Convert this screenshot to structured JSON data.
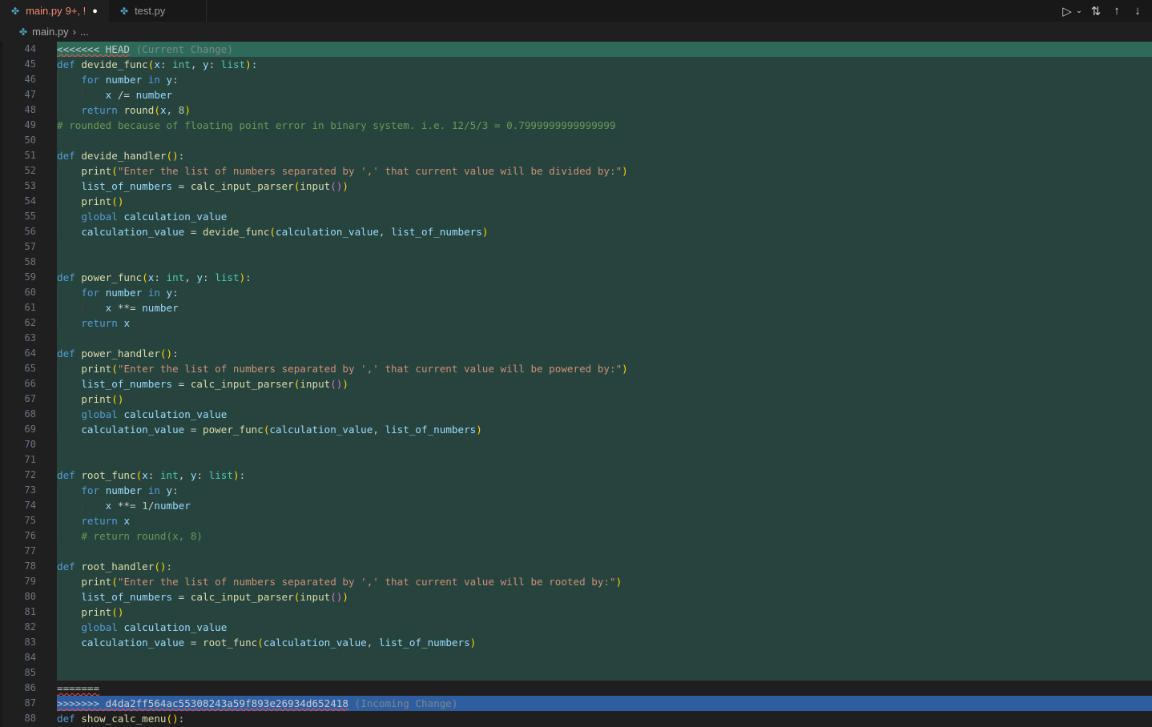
{
  "tabs": [
    {
      "label": "main.py",
      "badge": "9+, !",
      "dirty": "●",
      "active": true
    },
    {
      "label": "test.py",
      "active": false
    }
  ],
  "toolbar": {
    "run_icon": "play-icon",
    "run_dropdown_icon": "chevron-down-icon",
    "compare_icon": "git-compare-icon",
    "prev_icon": "arrow-up-icon",
    "next_icon": "arrow-down-icon"
  },
  "breadcrumb": {
    "file": "main.py",
    "rest": "..."
  },
  "conflict": {
    "current_marker": "<<<<<<< HEAD",
    "current_label": "(Current Change)",
    "separator": "=======",
    "incoming_marker": ">>>>>>> d4da2ff564ac55308243a59f893e26934d652418",
    "incoming_label": "(Incoming Change)"
  },
  "code_lines": [
    {
      "n": "44",
      "bg": "current-head"
    },
    {
      "n": "45",
      "bg": "current"
    },
    {
      "n": "46",
      "bg": "current"
    },
    {
      "n": "47",
      "bg": "current"
    },
    {
      "n": "48",
      "bg": "current"
    },
    {
      "n": "49",
      "bg": "current",
      "comment": "# rounded because of floating point error in binary system. i.e. 12/5/3 = 0.7999999999999999"
    },
    {
      "n": "50",
      "bg": "current"
    },
    {
      "n": "51",
      "bg": "current"
    },
    {
      "n": "52",
      "bg": "current",
      "string": "\"Enter the list of numbers separated by ',' that current value will be divided by:\""
    },
    {
      "n": "53",
      "bg": "current"
    },
    {
      "n": "54",
      "bg": "current"
    },
    {
      "n": "55",
      "bg": "current"
    },
    {
      "n": "56",
      "bg": "current"
    },
    {
      "n": "57",
      "bg": "current"
    },
    {
      "n": "58",
      "bg": "current"
    },
    {
      "n": "59",
      "bg": "current"
    },
    {
      "n": "60",
      "bg": "current"
    },
    {
      "n": "61",
      "bg": "current"
    },
    {
      "n": "62",
      "bg": "current"
    },
    {
      "n": "63",
      "bg": "current"
    },
    {
      "n": "64",
      "bg": "current"
    },
    {
      "n": "65",
      "bg": "current",
      "string": "\"Enter the list of numbers separated by ',' that current value will be powered by:\""
    },
    {
      "n": "66",
      "bg": "current"
    },
    {
      "n": "67",
      "bg": "current"
    },
    {
      "n": "68",
      "bg": "current"
    },
    {
      "n": "69",
      "bg": "current"
    },
    {
      "n": "70",
      "bg": "current"
    },
    {
      "n": "71",
      "bg": "current"
    },
    {
      "n": "72",
      "bg": "current"
    },
    {
      "n": "73",
      "bg": "current"
    },
    {
      "n": "74",
      "bg": "current"
    },
    {
      "n": "75",
      "bg": "current"
    },
    {
      "n": "76",
      "bg": "current",
      "comment": "# return round(x, 8)"
    },
    {
      "n": "77",
      "bg": "current"
    },
    {
      "n": "78",
      "bg": "current"
    },
    {
      "n": "79",
      "bg": "current",
      "string": "\"Enter the list of numbers separated by ',' that current value will be rooted by:\""
    },
    {
      "n": "80",
      "bg": "current"
    },
    {
      "n": "81",
      "bg": "current"
    },
    {
      "n": "82",
      "bg": "current"
    },
    {
      "n": "83",
      "bg": "current"
    },
    {
      "n": "84",
      "bg": "current"
    },
    {
      "n": "85",
      "bg": "current"
    },
    {
      "n": "86",
      "bg": "none"
    },
    {
      "n": "87",
      "bg": "incoming-head"
    },
    {
      "n": "88",
      "bg": "none"
    }
  ],
  "identifiers": {
    "def": "def",
    "for": "for",
    "in": "in",
    "return": "return",
    "global": "global",
    "int": "int",
    "list": "list",
    "round": "round",
    "print": "print",
    "input": "input",
    "devide_func": "devide_func",
    "devide_handler": "devide_handler",
    "power_func": "power_func",
    "power_handler": "power_handler",
    "root_func": "root_func",
    "root_handler": "root_handler",
    "show_calc_menu": "show_calc_menu",
    "calc_input_parser": "calc_input_parser",
    "x": "x",
    "y": "y",
    "number": "number",
    "list_of_numbers": "list_of_numbers",
    "calculation_value": "calculation_value",
    "eight": "8",
    "one": "1"
  },
  "colors": {
    "current_header": "#2d6a5a",
    "current_body": "#26433e",
    "incoming_header": "#2f5ea0",
    "active_tab_text": "#f48771",
    "python_icon": "#519aba"
  }
}
